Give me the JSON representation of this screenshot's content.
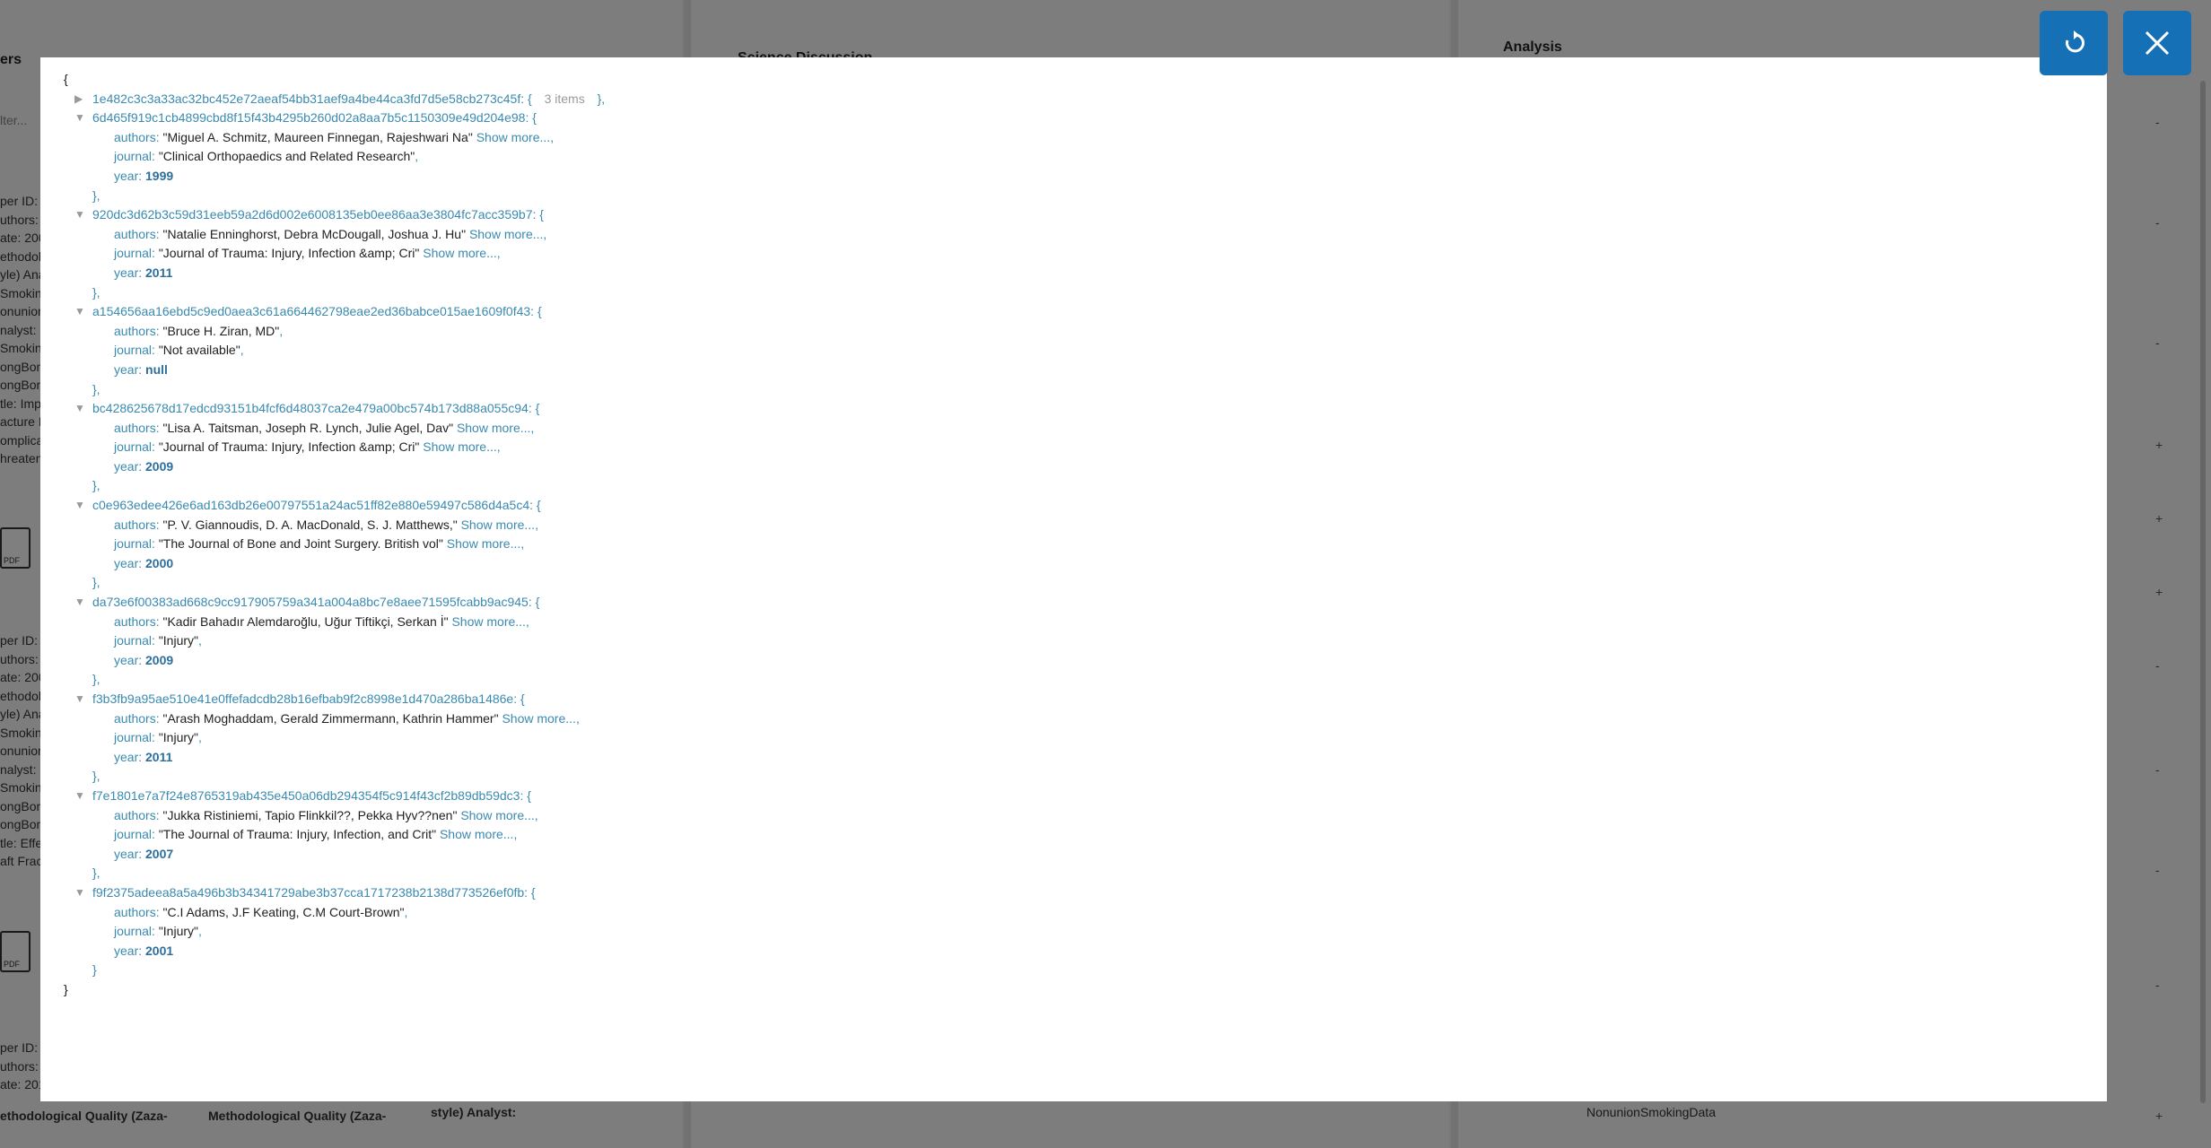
{
  "background": {
    "left_header": "ers",
    "left_filter": "lter...",
    "middle_header": "Science Discussion",
    "right_header": "Analysis",
    "left_rows": [
      "per ID:",
      "uthors:",
      "ate: 200",
      "ethodol",
      "yle) Ana",
      "Smoking",
      "onunion",
      "nalyst:",
      "Smoking",
      "ongBon",
      "ongBon",
      "tle: Imp",
      "acture I",
      "omplica",
      "hreaten"
    ],
    "left_rows_2": [
      "per ID:",
      "uthors:",
      "ate: 200",
      "ethodol",
      "yle) Ana",
      "Smoking",
      "onunion",
      "nalyst:",
      "Smoking",
      "ongBon",
      "ongBon",
      "tle: Effe",
      "aft Frac"
    ],
    "left_rows_3": [
      "per ID:",
      "uthors:",
      "ate: 201"
    ],
    "bottom_labels": [
      "ethodological Quality (Zaza-",
      "Methodological Quality (Zaza-",
      "style) Analyst:"
    ],
    "pdf_label": "PDF",
    "right_last_item": "NonunionSmokingData",
    "right_signs": [
      "-",
      "-",
      "-",
      "+",
      "+",
      "+",
      "-",
      "-",
      "-",
      "-",
      "+"
    ]
  },
  "modal": {
    "refresh_icon": "refresh-icon",
    "close_icon": "close-icon",
    "open_brace": "{",
    "close_brace": "}",
    "collapsed_entry": {
      "key": "1e482c3c3a33ac32bc452e72aeaf54bb31aef9a4be44ca3fd7d5e58cb273c45f",
      "count": "3 items"
    },
    "entries": [
      {
        "key": "6d465f919c1cb4899cbd8f15f43b4295b260d02a8aa7b5c1150309e49d204e98",
        "authors": "\"Miguel A. Schmitz, Maureen Finnegan, Rajeshwari Na\"",
        "authors_more": "Show more...",
        "journal": "\"Clinical Orthopaedics and Related Research\"",
        "journal_more": "",
        "year": "1999"
      },
      {
        "key": "920dc3d62b3c59d31eeb59a2d6d002e6008135eb0ee86aa3e3804fc7acc359b7",
        "authors": "\"Natalie Enninghorst, Debra McDougall, Joshua J. Hu\"",
        "authors_more": "Show more...",
        "journal": "\"Journal of Trauma: Injury, Infection &amp; Cri\"",
        "journal_more": "Show more...",
        "year": "2011"
      },
      {
        "key": "a154656aa16ebd5c9ed0aea3c61a664462798eae2ed36babce015ae1609f0f43",
        "authors": "\"Bruce H. Ziran, MD\"",
        "authors_more": "",
        "journal": "\"Not available\"",
        "journal_more": "",
        "year": "null"
      },
      {
        "key": "bc428625678d17edcd93151b4fcf6d48037ca2e479a00bc574b173d88a055c94",
        "authors": "\"Lisa A. Taitsman, Joseph R. Lynch, Julie Agel, Dav\"",
        "authors_more": "Show more...",
        "journal": "\"Journal of Trauma: Injury, Infection &amp; Cri\"",
        "journal_more": "Show more...",
        "year": "2009"
      },
      {
        "key": "c0e963edee426e6ad163db26e00797551a24ac51ff82e880e59497c586d4a5c4",
        "authors": "\"P. V. Giannoudis, D. A. MacDonald, S. J. Matthews,\"",
        "authors_more": "Show more...",
        "journal": "\"The Journal of Bone and Joint Surgery. British vol\"",
        "journal_more": "Show more...",
        "year": "2000"
      },
      {
        "key": "da73e6f00383ad668c9cc917905759a341a004a8bc7e8aee71595fcabb9ac945",
        "authors": "\"Kadir Bahadır Alemdaroğlu, Uğur Tiftikçi, Serkan İ\"",
        "authors_more": "Show more...",
        "journal": "\"Injury\"",
        "journal_more": "",
        "year": "2009"
      },
      {
        "key": "f3b3fb9a95ae510e41e0ffefadcdb28b16efbab9f2c8998e1d470a286ba1486e",
        "authors": "\"Arash Moghaddam, Gerald Zimmermann, Kathrin Hammer\"",
        "authors_more": "Show more...",
        "journal": "\"Injury\"",
        "journal_more": "",
        "year": "2011"
      },
      {
        "key": "f7e1801e7a7f24e8765319ab435e450a06db294354f5c914f43cf2b89db59dc3",
        "authors": "\"Jukka Ristiniemi, Tapio Flinkkil??, Pekka Hyv??nen\"",
        "authors_more": "Show more...",
        "journal": "\"The Journal of Trauma: Injury, Infection, and Crit\"",
        "journal_more": "Show more...",
        "year": "2007"
      },
      {
        "key": "f9f2375adeea8a5a496b3b34341729abe3b37cca1717238b2138d773526ef0fb",
        "authors": "\"C.I Adams, J.F Keating, C.M Court-Brown\"",
        "authors_more": "",
        "journal": "\"Injury\"",
        "journal_more": "",
        "year": "2001"
      }
    ],
    "field_labels": {
      "authors": "authors",
      "journal": "journal",
      "year": "year"
    }
  }
}
